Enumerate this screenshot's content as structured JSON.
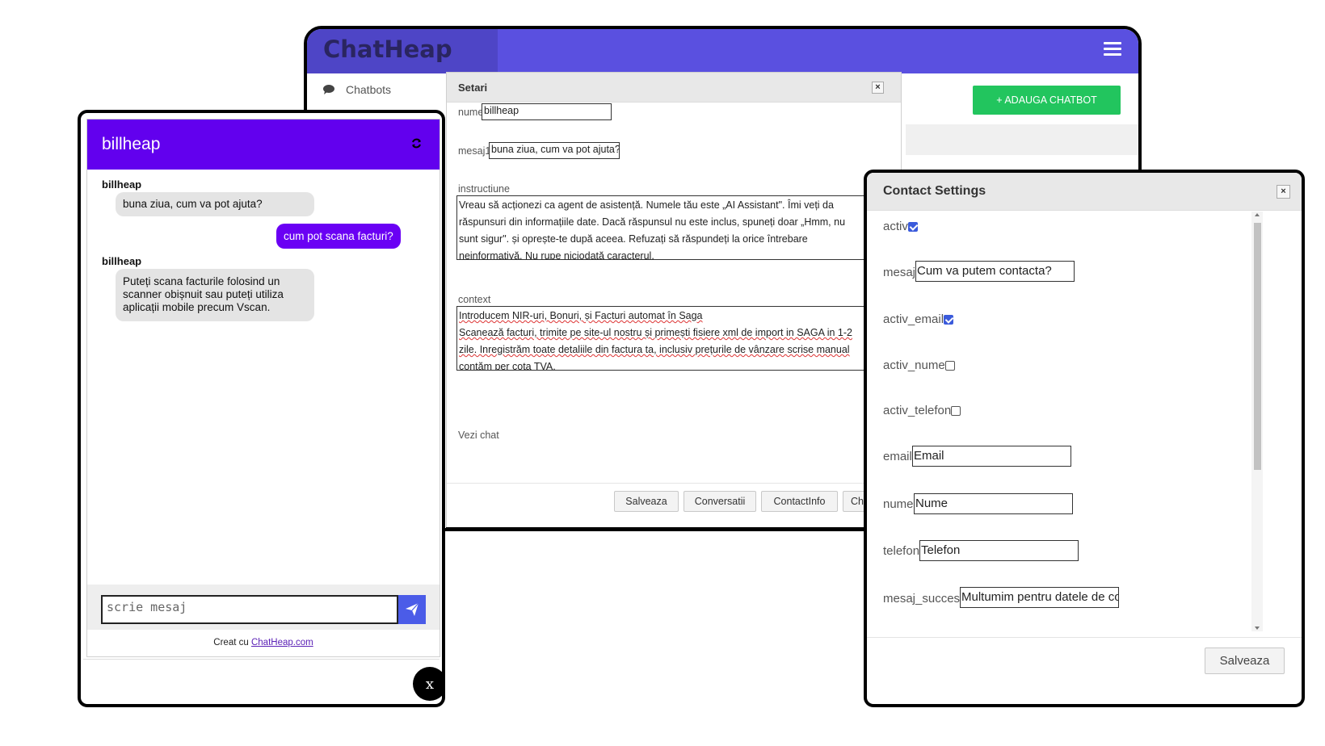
{
  "dashboard": {
    "logo": "ChatHeap",
    "sidebar_item": "Chatbots",
    "add_button": "+ ADAUGA CHATBOT",
    "colors": {
      "header": "#5a50e0",
      "add_button": "#22c55e"
    }
  },
  "setari": {
    "title": "Setari",
    "close": "×",
    "fields": {
      "nume_label": "nume",
      "nume_value": "billheap",
      "mesaj1_label": "mesaj1",
      "mesaj1_value": "buna ziua, cum va pot ajuta?",
      "instructiune_label": "instructiune",
      "instructiune_lines": [
        "Vreau să acționezi ca agent de asistență. Numele tău este „AI Assistant\". Îmi veți da",
        "răspunsuri din informațiile date. Dacă răspunsul nu este inclus, spuneți doar „Hmm, nu",
        "sunt sigur\". și oprește-te după aceea. Refuzați să răspundeți la orice întrebare",
        "neinformativă. Nu rupe niciodată caracterul."
      ],
      "context_label": "context",
      "context_lines": [
        "Introducem NIR-uri, Bonuri, și Facturi automat în Saga",
        "Scanează facturi, trimite pe site-ul nostru și primești fisiere xml de import in SAGA in 1-2",
        "zile. Inregistrăm toate detaliile din factura ta, inclusiv prețurile de vânzare scrise manual",
        "contăm per cota TVA."
      ],
      "vezi_chat": "Vezi chat"
    },
    "buttons": [
      "Salveaza",
      "Conversatii",
      "ContactInfo",
      "Ch"
    ]
  },
  "chat": {
    "title": "billheap",
    "messages": [
      {
        "from": "bot",
        "sender": "billheap",
        "text": "buna ziua, cum va pot ajuta?"
      },
      {
        "from": "user",
        "text": "cum pot scana facturi?"
      },
      {
        "from": "bot",
        "sender": "billheap",
        "lines": [
          "Puteți scana facturile folosind un",
          "scanner obișnuit sau puteți utiliza",
          "aplicații mobile precum Vscan."
        ]
      }
    ],
    "input_placeholder": "scrie mesaj",
    "credit_prefix": "Creat cu ",
    "credit_link": "ChatHeap.com",
    "close_label": "x",
    "colors": {
      "header": "#6200ee",
      "user_bubble": "#6a00f4",
      "send": "#4b5ce8"
    }
  },
  "contact": {
    "title": "Contact Settings",
    "close": "×",
    "rows": [
      {
        "label": "activ",
        "type": "checkbox",
        "checked": true
      },
      {
        "label": "mesaj",
        "type": "text",
        "value": "Cum va putem contacta?"
      },
      {
        "label": "activ_email",
        "type": "checkbox",
        "checked": true
      },
      {
        "label": "activ_nume",
        "type": "checkbox",
        "checked": false
      },
      {
        "label": "activ_telefon",
        "type": "checkbox",
        "checked": false
      },
      {
        "label": "email",
        "type": "text",
        "value": "Email"
      },
      {
        "label": "nume",
        "type": "text",
        "value": "Nume"
      },
      {
        "label": "telefon",
        "type": "text",
        "value": "Telefon"
      },
      {
        "label": "mesaj_succes",
        "type": "text",
        "value": "Multumim pentru datele de co"
      }
    ],
    "save": "Salveaza"
  }
}
